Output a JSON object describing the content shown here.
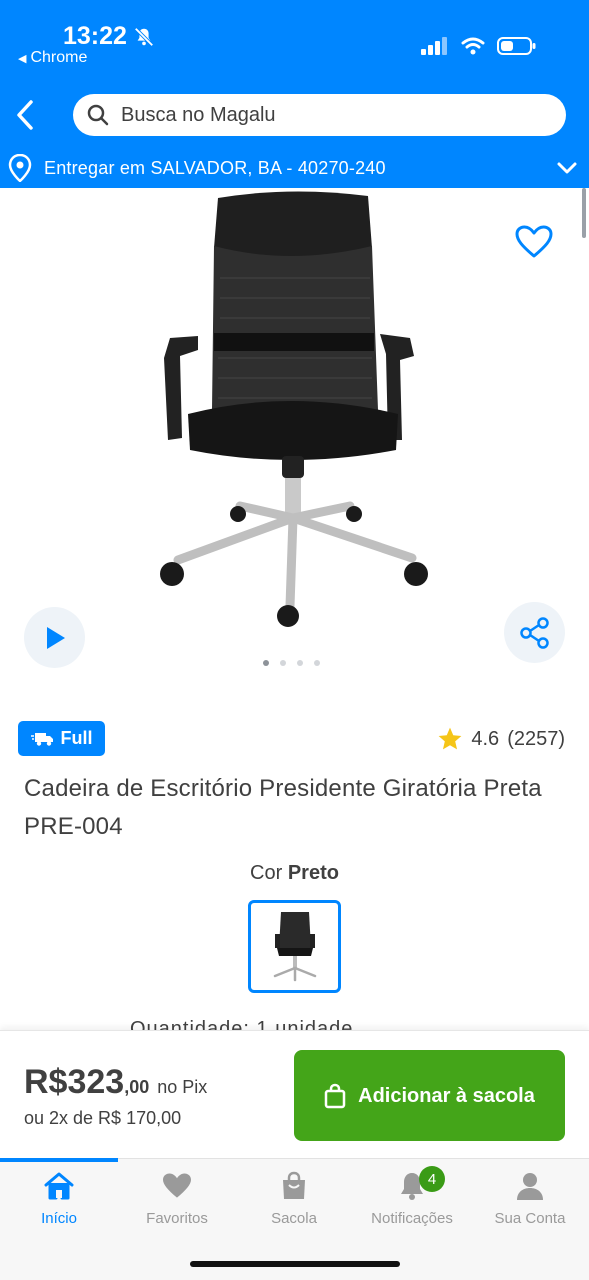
{
  "status": {
    "time": "13:22",
    "back_app": "Chrome"
  },
  "header": {
    "search_placeholder": "Busca no Magalu",
    "delivery": "Entregar em SALVADOR, BA - 40270-240"
  },
  "gallery": {
    "image_count": 4,
    "active_index": 0
  },
  "product": {
    "badge": "Full",
    "rating": "4.6",
    "reviews": "(2257)",
    "title": "Cadeira de Escritório Presidente Giratória Preta PRE-004",
    "color_label": "Cor",
    "color_value": "Preto",
    "qty_peek": "Quantidade:    1 unidade"
  },
  "buy": {
    "price_main": "R$323",
    "price_cents": ",00",
    "price_method": "no Pix",
    "installments": "ou 2x de R$ 170,00",
    "add_label": "Adicionar à sacola"
  },
  "nav": {
    "items": [
      {
        "label": "Início",
        "icon": "home-icon",
        "active": true
      },
      {
        "label": "Favoritos",
        "icon": "heart-icon"
      },
      {
        "label": "Sacola",
        "icon": "bag-icon"
      },
      {
        "label": "Notificações",
        "icon": "bell-icon",
        "badge": "4"
      },
      {
        "label": "Sua Conta",
        "icon": "user-icon"
      }
    ]
  },
  "colors": {
    "brand_blue": "#0086ff",
    "buy_green": "#44a519",
    "badge_green": "#3a9b16"
  }
}
